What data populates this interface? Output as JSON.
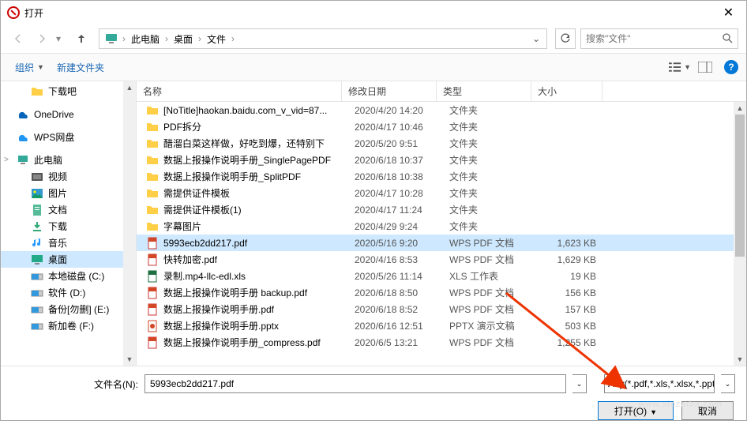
{
  "title": "打开",
  "breadcrumb": {
    "root": "此电脑",
    "p1": "桌面",
    "p2": "文件"
  },
  "search": {
    "placeholder": "搜索\"文件\""
  },
  "toolbar": {
    "organize": "组织",
    "newfolder": "新建文件夹"
  },
  "sidebar": [
    {
      "label": "下载吧",
      "icon": "folder",
      "indent": true
    },
    {
      "label": "OneDrive",
      "icon": "onedrive",
      "indent": false,
      "gapBefore": true
    },
    {
      "label": "WPS网盘",
      "icon": "wps",
      "indent": false,
      "gapBefore": true
    },
    {
      "label": "此电脑",
      "icon": "pc",
      "indent": false,
      "gapBefore": true,
      "arrow": ">"
    },
    {
      "label": "视频",
      "icon": "video",
      "indent": true
    },
    {
      "label": "图片",
      "icon": "pic",
      "indent": true
    },
    {
      "label": "文档",
      "icon": "doc",
      "indent": true
    },
    {
      "label": "下载",
      "icon": "dl",
      "indent": true
    },
    {
      "label": "音乐",
      "icon": "music",
      "indent": true
    },
    {
      "label": "桌面",
      "icon": "desktop",
      "indent": true,
      "selected": true
    },
    {
      "label": "本地磁盘 (C:)",
      "icon": "disk",
      "indent": true
    },
    {
      "label": "软件 (D:)",
      "icon": "disk",
      "indent": true
    },
    {
      "label": "备份[勿删] (E:)",
      "icon": "disk",
      "indent": true
    },
    {
      "label": "新加卷 (F:)",
      "icon": "disk",
      "indent": true
    }
  ],
  "columns": {
    "name": "名称",
    "date": "修改日期",
    "type": "类型",
    "size": "大小"
  },
  "files": [
    {
      "name": "[NoTitle]haokan.baidu.com_v_vid=87...",
      "date": "2020/4/20 14:20",
      "type": "文件夹",
      "size": "",
      "icon": "folder"
    },
    {
      "name": "PDF拆分",
      "date": "2020/4/17 10:46",
      "type": "文件夹",
      "size": "",
      "icon": "folder"
    },
    {
      "name": "醋溜白菜这样做，好吃到爆，还特别下",
      "date": "2020/5/20 9:51",
      "type": "文件夹",
      "size": "",
      "icon": "folder"
    },
    {
      "name": "数据上报操作说明手册_SinglePagePDF",
      "date": "2020/6/18 10:37",
      "type": "文件夹",
      "size": "",
      "icon": "folder"
    },
    {
      "name": "数据上报操作说明手册_SplitPDF",
      "date": "2020/6/18 10:38",
      "type": "文件夹",
      "size": "",
      "icon": "folder"
    },
    {
      "name": "需提供证件模板",
      "date": "2020/4/17 10:28",
      "type": "文件夹",
      "size": "",
      "icon": "folder"
    },
    {
      "name": "需提供证件模板(1)",
      "date": "2020/4/17 11:24",
      "type": "文件夹",
      "size": "",
      "icon": "folder"
    },
    {
      "name": "字幕图片",
      "date": "2020/4/29 9:24",
      "type": "文件夹",
      "size": "",
      "icon": "folder"
    },
    {
      "name": "5993ecb2dd217.pdf",
      "date": "2020/5/16 9:20",
      "type": "WPS PDF 文档",
      "size": "1,623 KB",
      "icon": "pdf",
      "selected": true
    },
    {
      "name": "快转加密.pdf",
      "date": "2020/4/16 8:53",
      "type": "WPS PDF 文档",
      "size": "1,629 KB",
      "icon": "pdf"
    },
    {
      "name": "录制.mp4-llc-edl.xls",
      "date": "2020/5/26 11:14",
      "type": "XLS 工作表",
      "size": "19 KB",
      "icon": "xls"
    },
    {
      "name": "数据上报操作说明手册 backup.pdf",
      "date": "2020/6/18 8:50",
      "type": "WPS PDF 文档",
      "size": "156 KB",
      "icon": "pdf"
    },
    {
      "name": "数据上报操作说明手册.pdf",
      "date": "2020/6/18 8:52",
      "type": "WPS PDF 文档",
      "size": "157 KB",
      "icon": "pdf"
    },
    {
      "name": "数据上报操作说明手册.pptx",
      "date": "2020/6/16 12:51",
      "type": "PPTX 演示文稿",
      "size": "503 KB",
      "icon": "pptx"
    },
    {
      "name": "数据上报操作说明手册_compress.pdf",
      "date": "2020/6/5 13:21",
      "type": "WPS PDF 文档",
      "size": "1,255 KB",
      "icon": "pdf"
    }
  ],
  "filename": {
    "label": "文件名(N):",
    "value": "5993ecb2dd217.pdf"
  },
  "filter": "Any(*.pdf,*.xls,*.xlsx,*.ppt,*.pptx)",
  "buttons": {
    "open": "打开(O)",
    "cancel": "取消"
  },
  "watermark": "www.xiazaiba.com"
}
